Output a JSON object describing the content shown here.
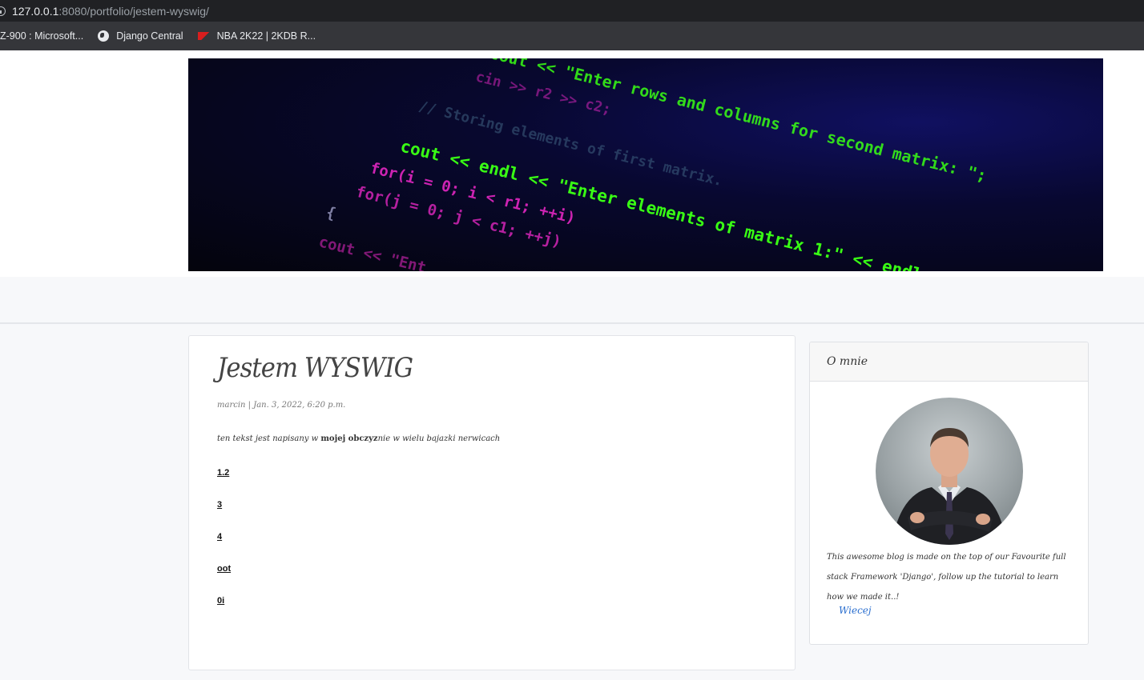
{
  "browser": {
    "url_host": "127.0.0.1",
    "url_path": ":8080/portfolio/jestem-wyswig/",
    "bookmarks": [
      {
        "label": "Z-900 : Microsoft..."
      },
      {
        "label": "Django Central"
      },
      {
        "label": "NBA 2K22 | 2KDB R..."
      }
    ]
  },
  "hero": {
    "code_lines": [
      "cout << \"Enter rows and columns for second matrix: \";",
      "cin >> r2 >> c2;",
      "// Storing elements of first matrix.",
      "cout << endl << \"Enter elements of matrix 1:\" << endl;",
      "for(i = 0; i < r1; ++i)",
      "for(j = 0; j < c1; ++j)",
      "{",
      "cout << \"Ent"
    ]
  },
  "post": {
    "title": "Jestem WYSWIG",
    "meta": "marcin | Jan. 3, 2022, 6:20 p.m.",
    "body_prefix": "ten tekst jest napisany w ",
    "body_bold": "mojej obczyz",
    "body_suffix": "nie w wielu bajazki nerwicach",
    "links": [
      "1.2",
      "3",
      "4",
      "oot",
      "0i"
    ]
  },
  "sidebar": {
    "header": "O mnie",
    "text": "This awesome blog is made on the top of our Favourite full stack Framework 'Django', follow up the tutorial to learn how we made it..!",
    "button": "Wiecej"
  },
  "colors": {
    "accent": "#2b6fcf",
    "code_green": "#39ff14",
    "code_pink": "#ff2bd6"
  }
}
